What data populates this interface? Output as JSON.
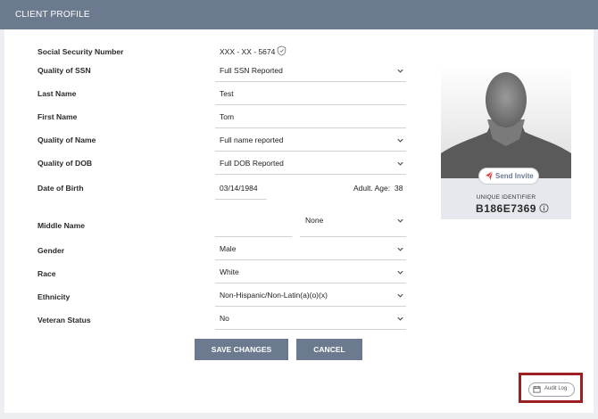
{
  "header": {
    "title": "CLIENT PROFILE"
  },
  "fields": [
    {
      "label": "Social Security Number",
      "value": "XXX - XX - 5674"
    },
    {
      "label": "Quality of SSN",
      "value": "Full SSN Reported"
    },
    {
      "label": "Last Name",
      "value": "Test"
    },
    {
      "label": "First Name",
      "value": "Tom"
    },
    {
      "label": "Quality of Name",
      "value": "Full name reported"
    },
    {
      "label": "Quality of DOB",
      "value": "Full DOB Reported"
    },
    {
      "label": "Date of Birth",
      "value": "03/14/1984",
      "age_label": "Adult. Age:",
      "age": "38"
    },
    {
      "label": "Middle Name",
      "value": "",
      "suffix": "None"
    },
    {
      "label": "Gender",
      "value": "Male"
    },
    {
      "label": "Race",
      "value": "White"
    },
    {
      "label": "Ethnicity",
      "value": "Non-Hispanic/Non-Latin(a)(o)(x)"
    },
    {
      "label": "Veteran Status",
      "value": "No"
    }
  ],
  "buttons": {
    "save": "SAVE CHANGES",
    "cancel": "CANCEL"
  },
  "profile": {
    "send_invite": "Send Invite",
    "uid_label": "UNIQUE IDENTIFIER",
    "uid_value": "B186E7369"
  },
  "audit": {
    "label": "Audit Log"
  },
  "icons": {
    "shield": "shield-icon",
    "chevron": "chevron-down-icon",
    "info": "info-icon",
    "invite": "send-icon",
    "calendar": "calendar-icon"
  },
  "colors": {
    "header": "#6b7a8f",
    "accent": "#e03a3a",
    "highlight": "#9c1f22"
  }
}
